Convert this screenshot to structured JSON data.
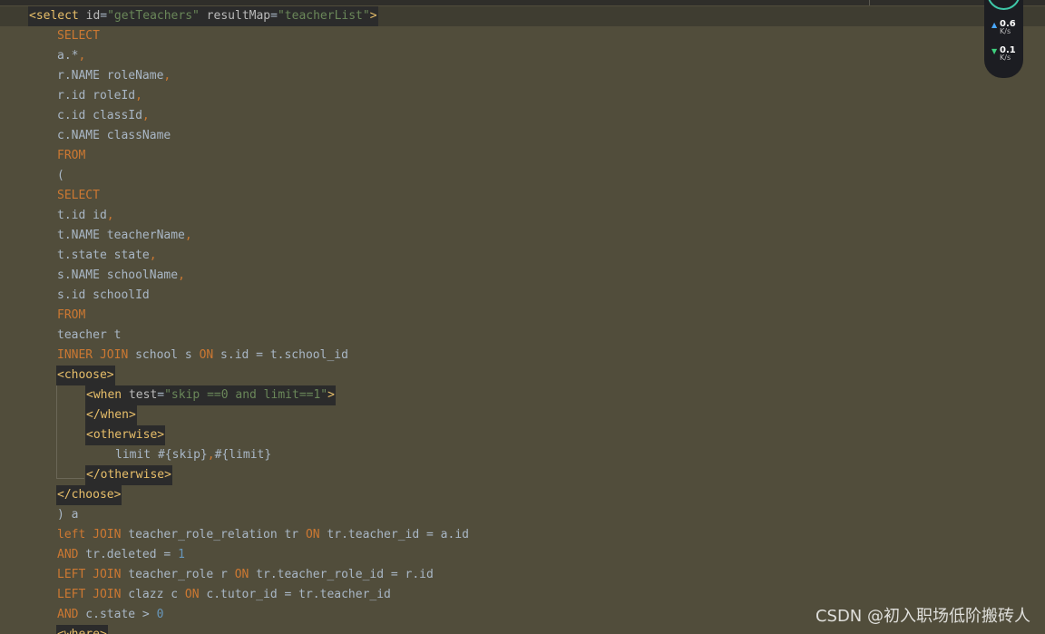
{
  "editor": {
    "lines": [
      {
        "indent": 32,
        "current": true,
        "tagbg": true,
        "tokens": [
          {
            "t": "<select",
            "c": "tag"
          },
          {
            "t": " id",
            "c": "attr"
          },
          {
            "t": "=",
            "c": "txt"
          },
          {
            "t": "\"getTeachers\"",
            "c": "str"
          },
          {
            "t": " resultMap",
            "c": "attr"
          },
          {
            "t": "=",
            "c": "txt"
          },
          {
            "t": "\"teacherList\"",
            "c": "str"
          },
          {
            "t": ">",
            "c": "tag"
          }
        ]
      },
      {
        "indent": 63,
        "tokens": [
          {
            "t": "SELECT",
            "c": "kw"
          }
        ]
      },
      {
        "indent": 63,
        "tokens": [
          {
            "t": "a.*",
            "c": "txt"
          },
          {
            "t": ",",
            "c": "kw"
          }
        ]
      },
      {
        "indent": 63,
        "tokens": [
          {
            "t": "r.NAME roleName",
            "c": "txt"
          },
          {
            "t": ",",
            "c": "kw"
          }
        ]
      },
      {
        "indent": 63,
        "tokens": [
          {
            "t": "r.id roleId",
            "c": "txt"
          },
          {
            "t": ",",
            "c": "kw"
          }
        ]
      },
      {
        "indent": 63,
        "tokens": [
          {
            "t": "c.id classId",
            "c": "txt"
          },
          {
            "t": ",",
            "c": "kw"
          }
        ]
      },
      {
        "indent": 63,
        "tokens": [
          {
            "t": "c.NAME className",
            "c": "txt"
          }
        ]
      },
      {
        "indent": 63,
        "tokens": [
          {
            "t": "FROM",
            "c": "kw"
          }
        ]
      },
      {
        "indent": 63,
        "tokens": [
          {
            "t": "(",
            "c": "txt"
          }
        ]
      },
      {
        "indent": 63,
        "tokens": [
          {
            "t": "SELECT",
            "c": "kw"
          }
        ]
      },
      {
        "indent": 63,
        "tokens": [
          {
            "t": "t.id id",
            "c": "txt"
          },
          {
            "t": ",",
            "c": "kw"
          }
        ]
      },
      {
        "indent": 63,
        "tokens": [
          {
            "t": "t.NAME teacherName",
            "c": "txt"
          },
          {
            "t": ",",
            "c": "kw"
          }
        ]
      },
      {
        "indent": 63,
        "tokens": [
          {
            "t": "t.state state",
            "c": "txt"
          },
          {
            "t": ",",
            "c": "kw"
          }
        ]
      },
      {
        "indent": 63,
        "tokens": [
          {
            "t": "s.NAME schoolName",
            "c": "txt"
          },
          {
            "t": ",",
            "c": "kw"
          }
        ]
      },
      {
        "indent": 63,
        "tokens": [
          {
            "t": "s.id schoolId",
            "c": "txt"
          }
        ]
      },
      {
        "indent": 63,
        "tokens": [
          {
            "t": "FROM",
            "c": "kw"
          }
        ]
      },
      {
        "indent": 63,
        "tokens": [
          {
            "t": "teacher t",
            "c": "txt"
          }
        ]
      },
      {
        "indent": 63,
        "tokens": [
          {
            "t": "INNER JOIN",
            "c": "kw"
          },
          {
            "t": " school s ",
            "c": "txt"
          },
          {
            "t": "ON",
            "c": "kw"
          },
          {
            "t": " s.id = t.school_id",
            "c": "txt"
          }
        ]
      },
      {
        "indent": 63,
        "tagbg": true,
        "tokens": [
          {
            "t": "<choose>",
            "c": "tag"
          }
        ]
      },
      {
        "indent": 95,
        "tagbg": true,
        "tokens": [
          {
            "t": "<when",
            "c": "tag"
          },
          {
            "t": " test",
            "c": "attr"
          },
          {
            "t": "=",
            "c": "txt"
          },
          {
            "t": "\"skip ==0 and limit==1\"",
            "c": "str"
          },
          {
            "t": ">",
            "c": "tag"
          }
        ]
      },
      {
        "indent": 95,
        "tagbg": true,
        "tokens": [
          {
            "t": "</when>",
            "c": "tag"
          }
        ]
      },
      {
        "indent": 95,
        "tagbg": true,
        "tokens": [
          {
            "t": "<otherwise>",
            "c": "tag"
          }
        ]
      },
      {
        "indent": 127,
        "tokens": [
          {
            "t": "limit #{skip}",
            "c": "txt"
          },
          {
            "t": ",",
            "c": "kw"
          },
          {
            "t": "#{limit}",
            "c": "txt"
          }
        ]
      },
      {
        "indent": 95,
        "tagbg": true,
        "tokens": [
          {
            "t": "</otherwise>",
            "c": "tag"
          }
        ]
      },
      {
        "indent": 63,
        "tagbg": true,
        "tokens": [
          {
            "t": "</choose>",
            "c": "tag"
          }
        ]
      },
      {
        "indent": 63,
        "tokens": [
          {
            "t": ") a",
            "c": "txt"
          }
        ]
      },
      {
        "indent": 63,
        "tokens": [
          {
            "t": "left JOIN",
            "c": "kw"
          },
          {
            "t": " teacher_role_relation tr ",
            "c": "txt"
          },
          {
            "t": "ON",
            "c": "kw"
          },
          {
            "t": " tr.teacher_id = a.id",
            "c": "txt"
          }
        ]
      },
      {
        "indent": 63,
        "tokens": [
          {
            "t": "AND",
            "c": "kw"
          },
          {
            "t": " tr.deleted = ",
            "c": "txt"
          },
          {
            "t": "1",
            "c": "num"
          }
        ]
      },
      {
        "indent": 63,
        "tokens": [
          {
            "t": "LEFT JOIN",
            "c": "kw"
          },
          {
            "t": " teacher_role r ",
            "c": "txt"
          },
          {
            "t": "ON",
            "c": "kw"
          },
          {
            "t": " tr.teacher_role_id = r.id",
            "c": "txt"
          }
        ]
      },
      {
        "indent": 63,
        "tokens": [
          {
            "t": "LEFT JOIN",
            "c": "kw"
          },
          {
            "t": " clazz c ",
            "c": "txt"
          },
          {
            "t": "ON",
            "c": "kw"
          },
          {
            "t": " c.tutor_id = tr.teacher_id",
            "c": "txt"
          }
        ]
      },
      {
        "indent": 63,
        "tokens": [
          {
            "t": "AND",
            "c": "kw"
          },
          {
            "t": " c.state > ",
            "c": "txt"
          },
          {
            "t": "0",
            "c": "num"
          }
        ]
      },
      {
        "indent": 63,
        "tagbg": true,
        "tokens": [
          {
            "t": "<where>",
            "c": "tag"
          }
        ]
      }
    ]
  },
  "network": {
    "upload_value": "0.6",
    "upload_unit": "K/s",
    "download_value": "0.1",
    "download_unit": "K/s"
  },
  "watermark": {
    "text": "CSDN @初入职场低阶搬砖人"
  },
  "colors": {
    "background": "#514d3b",
    "keyword": "#cc7832",
    "tag": "#e8bf6a",
    "string": "#6a8759",
    "number": "#6897bb",
    "text": "#a9b7c6"
  }
}
